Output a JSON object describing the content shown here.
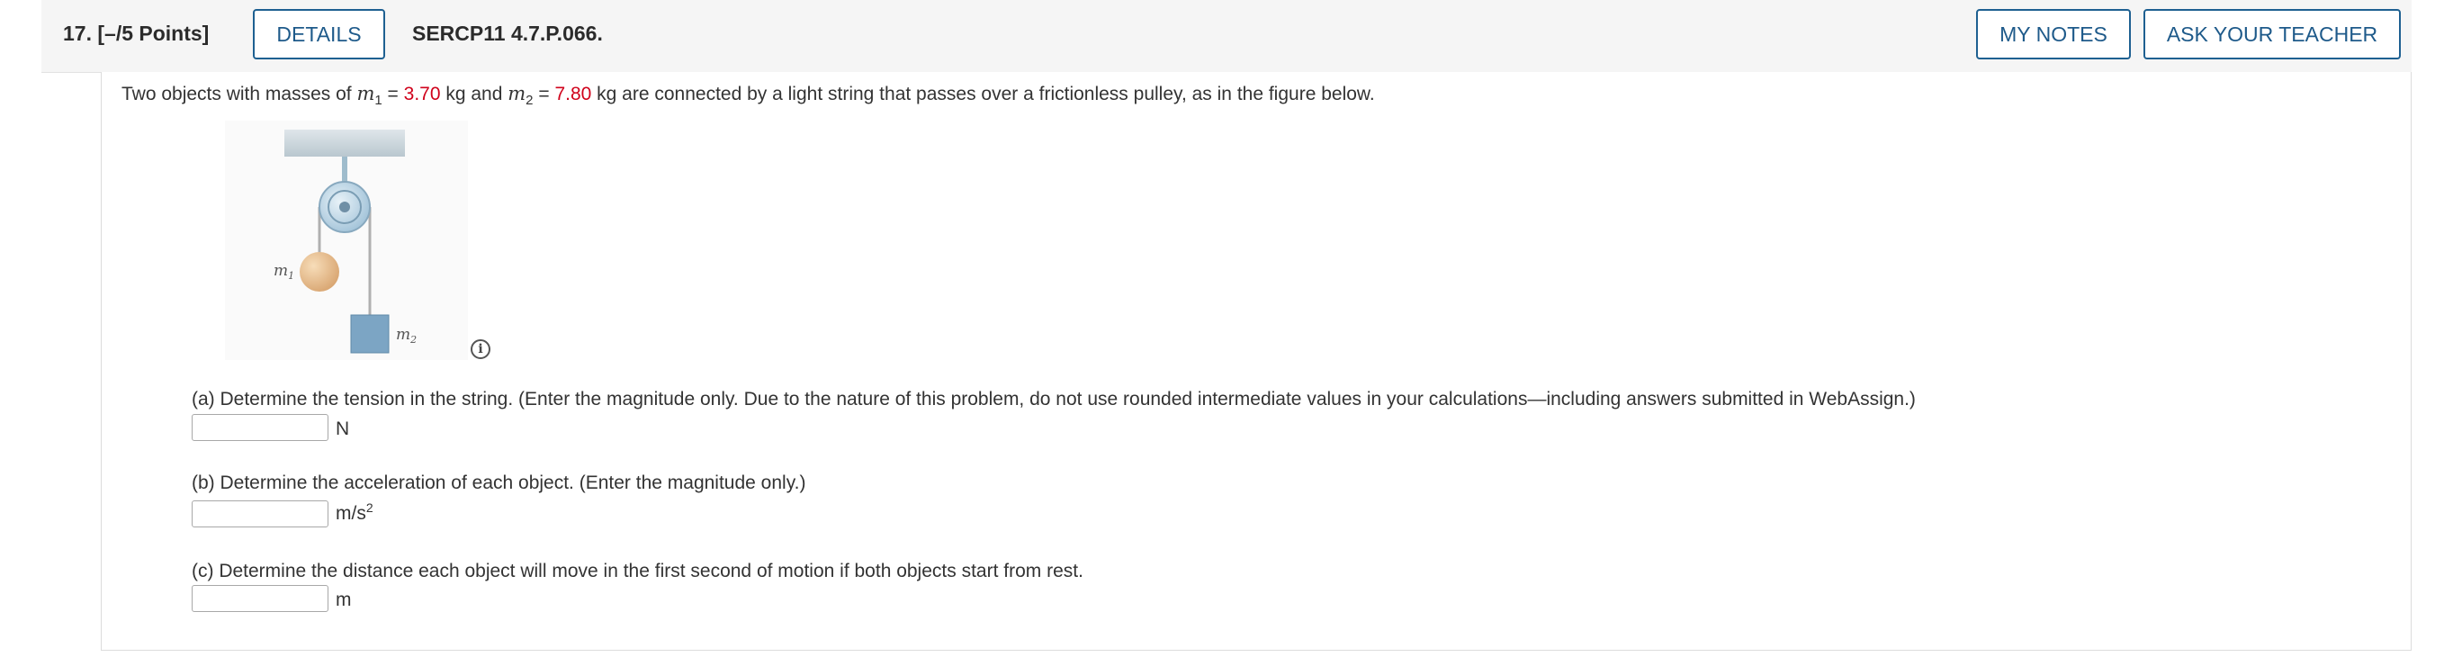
{
  "question": {
    "number_points": "17.  [–/5 Points]",
    "details_label": "DETAILS",
    "code": "SERCP11 4.7.P.066.",
    "my_notes_label": "MY NOTES",
    "ask_teacher_label": "ASK YOUR TEACHER"
  },
  "intro": {
    "prefix": "Two objects with masses of ",
    "m1_symbol": "m",
    "m1_sub": "1",
    "eq1": " = ",
    "m1_value": "3.70",
    "mid": " kg and ",
    "m2_symbol": "m",
    "m2_sub": "2",
    "eq2": " = ",
    "m2_value": "7.80",
    "suffix": " kg are connected by a light string that passes over a frictionless pulley, as in the figure below."
  },
  "figure": {
    "m1_label": "m",
    "m1_sub": "1",
    "m2_label": "m",
    "m2_sub": "2",
    "info_icon": "i"
  },
  "parts": [
    {
      "text": "(a) Determine the tension in the string. (Enter the magnitude only. Due to the nature of this problem, do not use rounded intermediate values in your calculations—including answers submitted in WebAssign.)",
      "unit": "N",
      "unit_sup": "",
      "value": ""
    },
    {
      "text": "(b) Determine the acceleration of each object. (Enter the magnitude only.)",
      "unit": "m/s",
      "unit_sup": "2",
      "value": ""
    },
    {
      "text": "(c) Determine the distance each object will move in the first second of motion if both objects start from rest.",
      "unit": "m",
      "unit_sup": "",
      "value": ""
    }
  ],
  "colors": {
    "accent": "#1e6091",
    "given_value": "#d0021b"
  }
}
